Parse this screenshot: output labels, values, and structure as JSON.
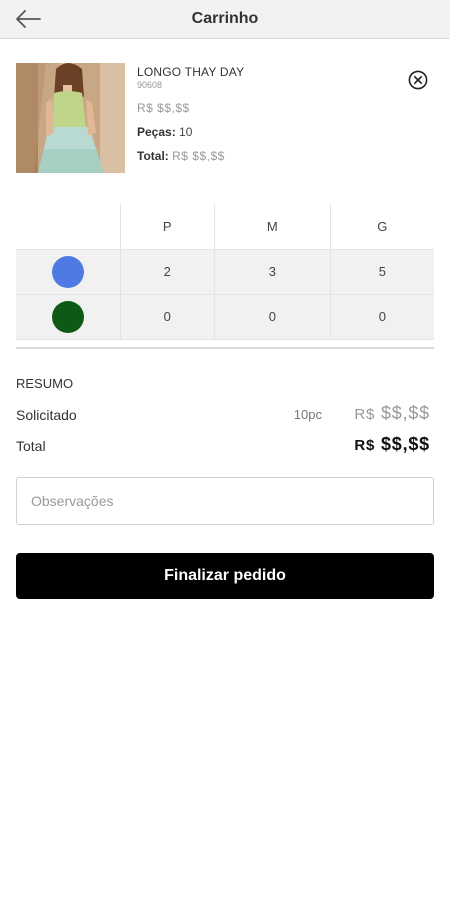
{
  "header": {
    "title": "Carrinho",
    "back_icon": "arrow-left-icon"
  },
  "product": {
    "name": "LONGO THAY DAY",
    "code": "90608",
    "price": "R$ $$,$$",
    "pieces_label": "Peças:",
    "pieces_value": "10",
    "total_label": "Total:",
    "total_value": "R$ $$,$$",
    "remove_icon": "close-circle-icon"
  },
  "grid": {
    "sizes": [
      "P",
      "M",
      "G"
    ],
    "rows": [
      {
        "color": "#4f7ae3",
        "values": [
          "2",
          "3",
          "5"
        ]
      },
      {
        "color": "#0e5a14",
        "values": [
          "0",
          "0",
          "0"
        ]
      }
    ]
  },
  "summary": {
    "title": "RESUMO",
    "requested_label": "Solicitado",
    "requested_qty": "10pc",
    "requested_currency": "R$",
    "requested_value": "$$,$$",
    "total_label": "Total",
    "total_currency": "R$",
    "total_value": "$$,$$"
  },
  "notes": {
    "placeholder": "Observações",
    "value": ""
  },
  "actions": {
    "finish_label": "Finalizar pedido"
  }
}
